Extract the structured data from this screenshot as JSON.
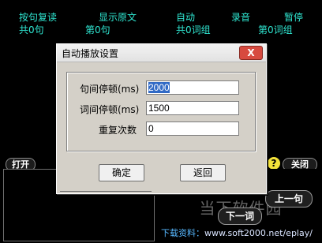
{
  "top": {
    "row1": [
      "按句复读",
      "显示原文",
      "自动",
      "录音",
      "暂停"
    ],
    "row2": [
      "共0句",
      "第0句",
      "共0词组",
      "第0词组"
    ]
  },
  "controls": {
    "open": "打开",
    "help": "?",
    "close": "关闭",
    "prev": "上一句",
    "next": "下一词"
  },
  "download": {
    "label": "下载资料：",
    "url": "www.soft2000.net/eplay/"
  },
  "watermark": "当下软件园",
  "dialog": {
    "title": "自动播放设置",
    "close_symbol": "X",
    "sentence_pause_label": "句间停顿(ms)",
    "sentence_pause_value": "2000",
    "word_pause_label": "词间停顿(ms)",
    "word_pause_value": "1500",
    "repeat_label": "重复次数",
    "repeat_value": "0",
    "ok": "确定",
    "back": "返回"
  }
}
